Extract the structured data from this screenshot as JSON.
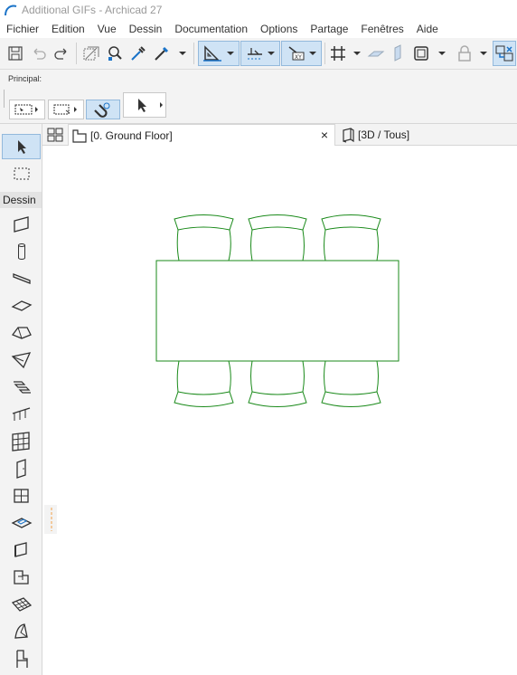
{
  "window": {
    "title": "Additional GIFs - Archicad 27"
  },
  "menu": [
    "Fichier",
    "Edition",
    "Vue",
    "Dessin",
    "Documentation",
    "Options",
    "Partage",
    "Fenêtres",
    "Aide"
  ],
  "infobox": {
    "label": "Principal:"
  },
  "toolbox": {
    "section_label": "Dessin"
  },
  "tabs": [
    {
      "label": "[0. Ground Floor]",
      "close": "×"
    },
    {
      "label": "[3D / Tous]"
    }
  ],
  "colors": {
    "drawing_stroke": "#1a8a1a",
    "selection": "#cfe3f5",
    "accent": "#1a73c8"
  },
  "canvas": {
    "content": "table with six chairs"
  }
}
